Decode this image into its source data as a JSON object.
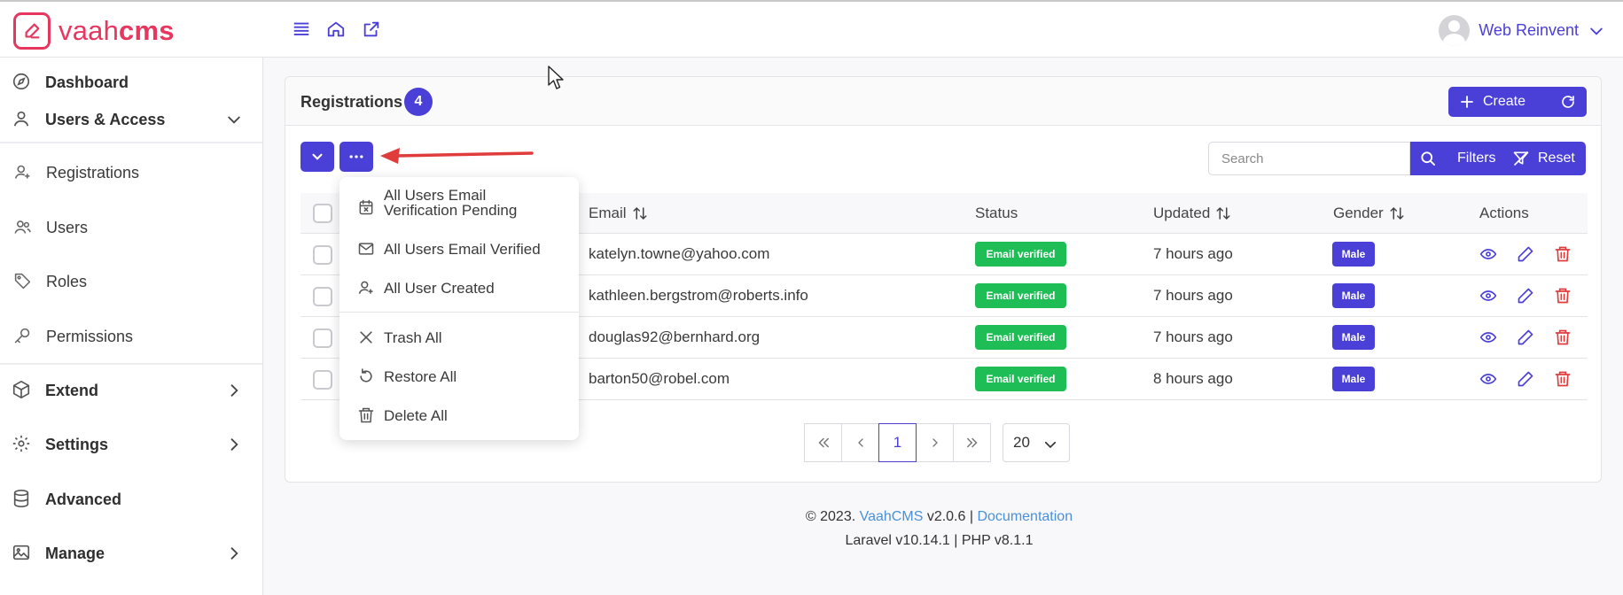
{
  "app": {
    "logo_prefix": "vaah",
    "logo_suffix": "cms",
    "brand_color": "#e7375f",
    "accent_color": "#4a3fd6",
    "user_name": "Web Reinvent"
  },
  "topbar_icons": [
    "menu-icon",
    "home-icon",
    "external-link-icon"
  ],
  "sidebar": {
    "items": [
      {
        "label": "Dashboard",
        "icon": "compass-icon"
      },
      {
        "label": "Users & Access",
        "icon": "user-icon",
        "expanded": true
      },
      {
        "label": "Registrations",
        "icon": "user-plus-icon"
      },
      {
        "label": "Users",
        "icon": "users-icon"
      },
      {
        "label": "Roles",
        "icon": "tag-icon"
      },
      {
        "label": "Permissions",
        "icon": "key-icon"
      },
      {
        "label": "Extend",
        "icon": "box-icon"
      },
      {
        "label": "Settings",
        "icon": "gear-icon"
      },
      {
        "label": "Advanced",
        "icon": "database-icon"
      },
      {
        "label": "Manage",
        "icon": "image-icon"
      }
    ]
  },
  "main": {
    "title": "Registrations",
    "count": "4",
    "create_label": "Create",
    "search_placeholder": "Search",
    "filters_label": "Filters",
    "reset_label": "Reset",
    "columns": [
      "Email",
      "Status",
      "Updated",
      "Gender",
      "Actions"
    ],
    "rows": [
      {
        "email": "katelyn.towne@yahoo.com",
        "status": "Email verified",
        "updated": "7 hours ago",
        "gender": "Male"
      },
      {
        "email": "kathleen.bergstrom@roberts.info",
        "status": "Email verified",
        "updated": "7 hours ago",
        "gender": "Male"
      },
      {
        "email": "douglas92@bernhard.org",
        "status": "Email verified",
        "updated": "7 hours ago",
        "gender": "Male"
      },
      {
        "email": "barton50@robel.com",
        "status": "Email verified",
        "updated": "8 hours ago",
        "gender": "Male"
      }
    ],
    "status_color": "#1fbd55",
    "pagination": {
      "current_page": "1",
      "per_page": "20"
    }
  },
  "dropdown": {
    "items": [
      {
        "label_line1": "All Users Email",
        "label_line2": "Verification Pending",
        "icon": "calendar-x-icon"
      },
      {
        "label": "All Users Email Verified",
        "icon": "mail-icon"
      },
      {
        "label": "All User Created",
        "icon": "user-plus-icon"
      },
      {
        "label": "Trash All",
        "icon": "x-icon"
      },
      {
        "label": "Restore All",
        "icon": "undo-icon"
      },
      {
        "label": "Delete All",
        "icon": "trash-icon"
      }
    ]
  },
  "footer": {
    "copyright": "© 2023.",
    "brand_link": "VaahCMS",
    "version": "v2.0.6",
    "separator": "|",
    "docs_link": "Documentation",
    "stack": "Laravel v10.14.1 | PHP v8.1.1"
  }
}
